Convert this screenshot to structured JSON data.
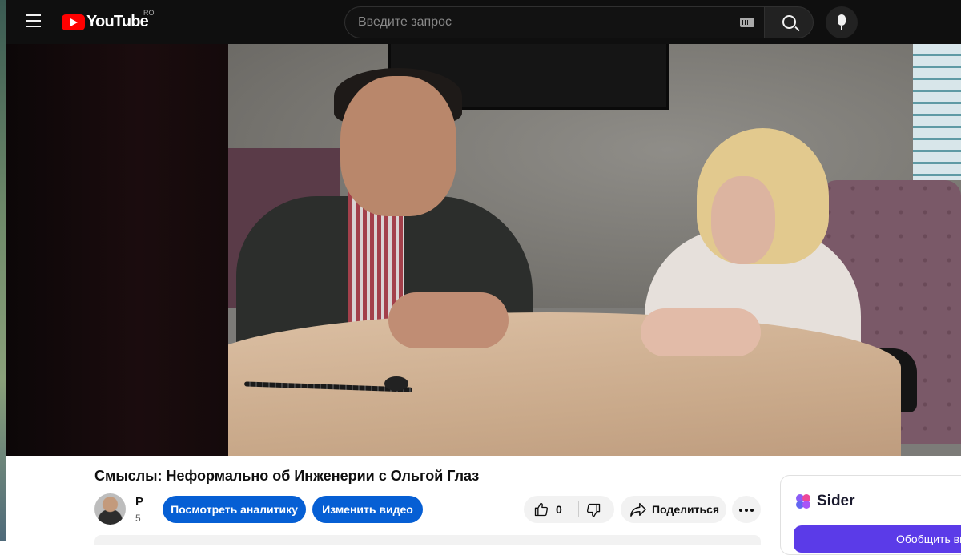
{
  "masthead": {
    "logo_text": "YouTube",
    "country_code": "RO",
    "search_placeholder": "Введите запрос",
    "icons": [
      "menu-icon",
      "keyboard-icon",
      "search-icon",
      "microphone-icon"
    ]
  },
  "video": {
    "title": "Смыслы: Неформально об Инженерии с Ольгой Глаз"
  },
  "owner": {
    "channel_name": "P",
    "subscribers": "5",
    "analytics_label": "Посмотреть аналитику",
    "edit_label": "Изменить видео"
  },
  "actions": {
    "like_count": "0",
    "share_label": "Поделиться",
    "icons": [
      "thumbs-up-icon",
      "thumbs-down-icon",
      "share-icon",
      "more-icon"
    ]
  },
  "sider": {
    "name": "Sider",
    "button_label": "Обобщить видео"
  },
  "colors": {
    "accent": "#065fd4",
    "brand_red": "#ff0000",
    "sider_purple": "#5b3be8"
  }
}
